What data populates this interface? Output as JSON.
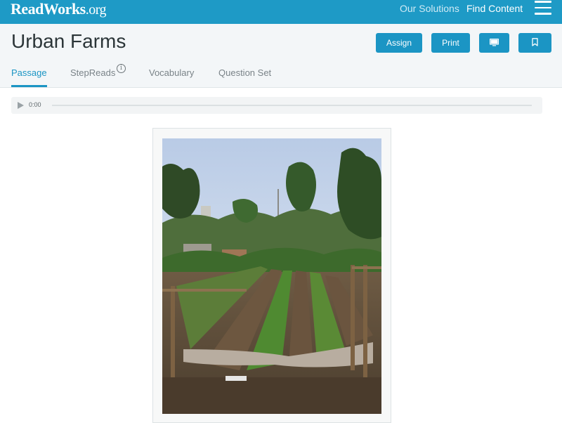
{
  "brand": {
    "name": "ReadWorks",
    "tld": ".org"
  },
  "nav": {
    "our_solutions": "Our Solutions",
    "find_content": "Find Content"
  },
  "page": {
    "title": "Urban Farms"
  },
  "actions": {
    "assign": "Assign",
    "print": "Print"
  },
  "tabs": [
    {
      "label": "Passage",
      "active": true
    },
    {
      "label": "StepReads",
      "info_icon": "i"
    },
    {
      "label": "Vocabulary"
    },
    {
      "label": "Question Set"
    }
  ],
  "audio": {
    "time": "0:00"
  },
  "colors": {
    "brand": "#1e9ac6",
    "button": "#1b95c4"
  },
  "icons": [
    "hamburger-menu-icon",
    "monitor-icon",
    "bookmark-icon",
    "info-icon",
    "play-icon"
  ]
}
